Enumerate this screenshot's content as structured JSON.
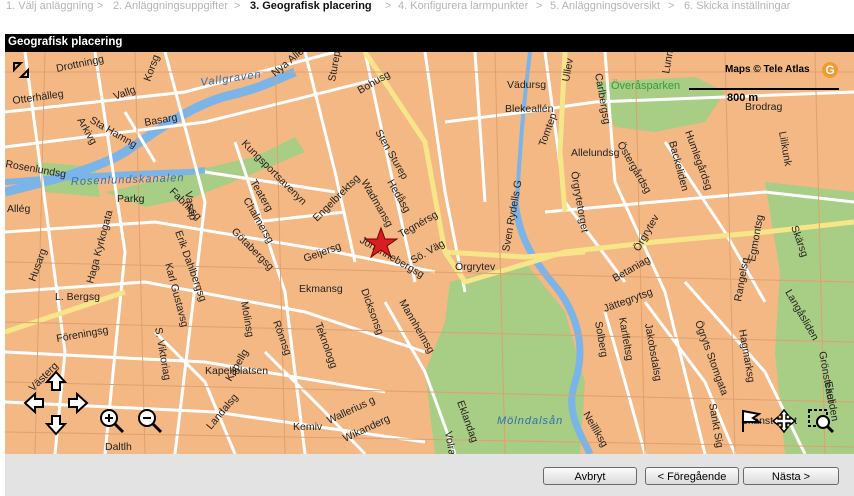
{
  "wizard": {
    "steps": [
      {
        "label": "1. Välj anläggning",
        "active": false
      },
      {
        "label": "2. Anläggningsuppgifter",
        "active": false
      },
      {
        "label": "3. Geografisk placering",
        "active": true
      },
      {
        "label": "4. Konfigurera larmpunkter",
        "active": false
      },
      {
        "label": "5. Anläggningsöversikt",
        "active": false
      },
      {
        "label": "6. Skicka inställningar",
        "active": false
      }
    ],
    "separator": ">"
  },
  "panel": {
    "title": "Geografisk placering"
  },
  "map": {
    "copyright": "Maps © Tele Atlas",
    "scale_label": "800 m",
    "water_labels": [
      "Vallgraven",
      "Rosenlundskanalen",
      "Mölndalsån"
    ],
    "park_labels": [
      "Överåsparken"
    ],
    "streets": [
      "Drottningg",
      "Otterhälleg",
      "Vallg",
      "Korsg",
      "Nya Allén",
      "Sturep",
      "Bohusg",
      "Vädursg",
      "Ullev",
      "Carlbergsg",
      "Lunnev",
      "Sta Hamng",
      "Basarg",
      "Arkivg",
      "Rosenlundsg",
      "Kungsportsavenyn",
      "Sten Sturep",
      "Blekeallén",
      "Tomtep",
      "Brodrag",
      "Parkg",
      "Fabriksg",
      "Vasap",
      "Teaterg",
      "Chalmersg",
      "Engelbrektsg",
      "Hedåsg",
      "Wadmansg",
      "Allelundsg",
      "Örgrytev",
      "Östergårdsg",
      "Humlegårdsg",
      "Backeliden",
      "Lilikunk",
      "Allég",
      "Haga Kyrkogata",
      "Erik Dahlbergsg",
      "Götabergsg",
      "Geijersg",
      "Johannebergsg",
      "Tegnérsg",
      "Sö. Väg",
      "Sven Rydells G",
      "Örgrytetorget",
      "Örgrytev",
      "Skärsg",
      "Egmontsg",
      "Husarg",
      "Karl Gustavsg",
      "L. Bergsg",
      "Ekmansg",
      "Dicksonsg",
      "Mannheimsg",
      "Betaniag",
      "Jättegrytsg",
      "Rangelsg",
      "Langåsliden",
      "Föreningsg",
      "S. Viktoriag",
      "Molinsg",
      "Rönnsg",
      "Teknologg",
      "Kapellplatsen",
      "Kapellg",
      "Landalsg",
      "Solberg",
      "Karlfeltsg",
      "Jakobsdalsg",
      "Ögryts Stomgata",
      "Hagmarksg",
      "Grönsteaut",
      "Ekeliden",
      "Västerg",
      "Skanstorget",
      "Kemiv",
      "Wallerius g",
      "Wikanderg",
      "Eklandag",
      "Volrat",
      "Neilliksg",
      "Sankt Sig",
      "Daltlh"
    ]
  },
  "controls": {
    "pan_up_icon": "arrow-up-icon",
    "pan_left_icon": "arrow-left-icon",
    "pan_right_icon": "arrow-right-icon",
    "pan_down_icon": "arrow-down-icon",
    "zoom_in_icon": "zoom-in-icon",
    "zoom_out_icon": "zoom-out-icon",
    "flag_icon": "flag-icon",
    "move_icon": "move-icon",
    "area_zoom_icon": "area-zoom-icon",
    "fullscreen_icon": "expand-icon"
  },
  "marker": {
    "icon": "star-marker-icon",
    "color": "#d42020"
  },
  "colors": {
    "map_land": "#f3b884",
    "park": "#a8cd84",
    "water": "#7bb4e8",
    "road": "#ffffff",
    "main_road": "#f7e58a",
    "header_bg": "#000000",
    "footer_bg": "#e3e3e3"
  },
  "footer": {
    "cancel_label": "Avbryt",
    "previous_label": "< Föregående",
    "next_label": "Nästa >"
  }
}
